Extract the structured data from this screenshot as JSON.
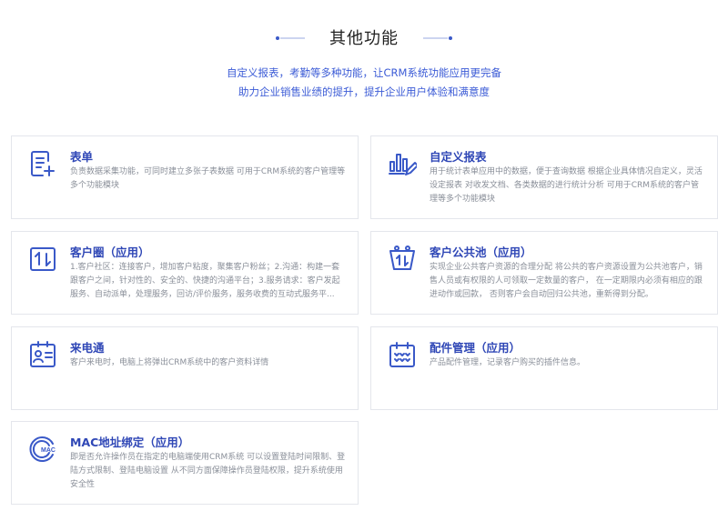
{
  "section": {
    "title": "其他功能",
    "subtitle_line1": "自定义报表，考勤等多种功能，让CRM系统功能应用更完备",
    "subtitle_line2": "助力企业销售业绩的提升，提升企业用户体验和满意度"
  },
  "colors": {
    "accent": "#3a59c8",
    "title_blue": "#2f47b6",
    "desc_gray": "#8a8f99",
    "border": "#e4e6ec"
  },
  "cards": [
    {
      "icon": "form-icon",
      "title": "表单",
      "desc": "负责数据采集功能，可同时建立多张子表数据 可用于CRM系统的客户管理等多个功能模块"
    },
    {
      "icon": "report-chart-icon",
      "title": "自定义报表",
      "desc": "用于统计表单应用中的数据，便于查询数据 根据企业具体情况自定义，灵活设定报表 对收发文档、各类数据的进行统计分析 可用于CRM系统的客户管理等多个功能模块"
    },
    {
      "icon": "exchange-icon",
      "title": "客户圈（应用）",
      "desc": "1.客户社区：连接客户，增加客户粘度，聚集客户粉丝；2.沟通：构建一套跟客户之间，针对性的、安全的、快捷的沟通平台；3.服务请求：客户发起服务、自动派单，处理服务，回访/评价服务，服务收费的互动式服务平..."
    },
    {
      "icon": "customer-pool-icon",
      "title": "客户公共池（应用）",
      "desc": "实现企业公共客户资源的合理分配 将公共的客户资源设置为公共池客户，销售人员或有权限的人可领取一定数量的客户， 在一定期限内必须有相应的跟进动作或回款， 否则客户会自动回归公共池，重新得到分配。"
    },
    {
      "icon": "caller-id-icon",
      "title": "来电通",
      "desc": "客户来电时，电脑上将弹出CRM系统中的客户资料详情"
    },
    {
      "icon": "calendar-icon",
      "title": "配件管理（应用）",
      "desc": "产品配件管理，记录客户购买的插件信息。"
    },
    {
      "icon": "mac-icon",
      "title": "MAC地址绑定（应用）",
      "desc": "即是否允许操作员在指定的电脑端使用CRM系统 可以设置登陆时间限制、登陆方式限制、登陆电脑设置 从不同方面保障操作员登陆权限，提升系统使用安全性"
    }
  ]
}
